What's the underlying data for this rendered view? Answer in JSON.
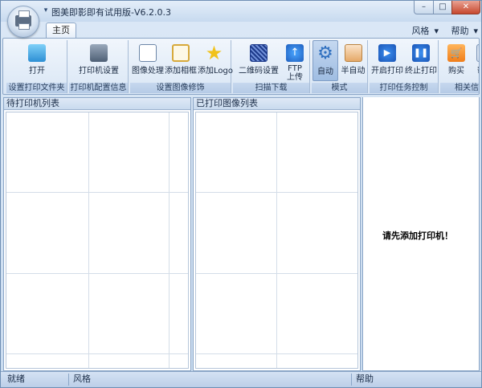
{
  "window": {
    "title": "图美即影即有试用版-V6.2.0.3",
    "controls": {
      "minimize": "–",
      "maximize": "□",
      "close": "✕"
    }
  },
  "quick_access": {
    "icons": [
      "app-menu-orb",
      "quick-access-dropdown"
    ]
  },
  "tabs": {
    "home": "主页"
  },
  "menu_right": {
    "style": "风格",
    "help": "帮助",
    "style_caret": "▾",
    "help_caret": "▾"
  },
  "ribbon": {
    "groups": [
      {
        "label": "设置打印文件夹",
        "buttons": [
          {
            "label": "打开",
            "icon": "folder-open-icon"
          }
        ]
      },
      {
        "label": "打印机配置信息",
        "buttons": [
          {
            "label": "打印机设置",
            "icon": "printer-icon"
          }
        ]
      },
      {
        "label": "设置图像修饰",
        "buttons": [
          {
            "label": "图像处理",
            "icon": "image-edit-icon"
          },
          {
            "label": "添加相框",
            "icon": "photo-frame-icon"
          },
          {
            "label": "添加Logo",
            "icon": "star-logo-icon"
          }
        ]
      },
      {
        "label": "扫描下载",
        "buttons": [
          {
            "label": "二维码设置",
            "icon": "qr-code-icon"
          },
          {
            "label_line1": "FTP",
            "label_line2": "上传",
            "icon": "ftp-upload-icon"
          }
        ]
      },
      {
        "label": "模式",
        "buttons": [
          {
            "label": "自动",
            "icon": "gear-auto-icon",
            "active": true
          },
          {
            "label": "半自动",
            "icon": "hand-semi-auto-icon"
          }
        ]
      },
      {
        "label": "打印任务控制",
        "buttons": [
          {
            "label": "开启打印",
            "icon": "play-icon"
          },
          {
            "label": "终止打印",
            "icon": "pause-icon"
          }
        ]
      },
      {
        "label": "相关信息",
        "buttons": [
          {
            "label": "购买",
            "icon": "cart-icon"
          },
          {
            "label": "帮助",
            "icon": "help-icon"
          }
        ]
      }
    ]
  },
  "panes": {
    "waiting": {
      "header": "待打印机列表"
    },
    "printed": {
      "header": "已打印图像列表"
    },
    "preview": {
      "message": "请先添加打印机！"
    }
  },
  "statusbar": {
    "state": "就绪",
    "style": "风格",
    "help": "帮助"
  },
  "colors": {
    "accent": "#2d8fd4",
    "ribbon_bg": "#dbe8f6",
    "border": "#8ba6c7"
  }
}
